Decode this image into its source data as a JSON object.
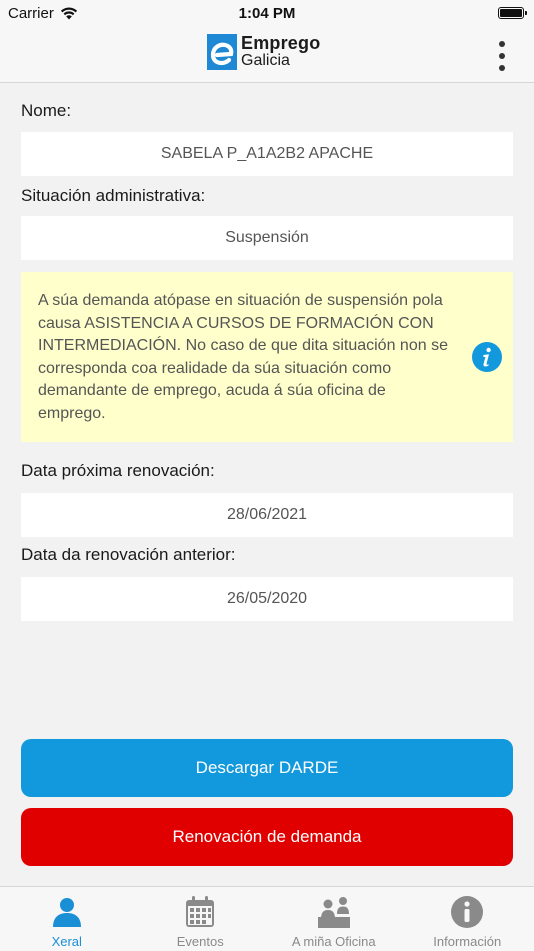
{
  "status_bar": {
    "carrier": "Carrier",
    "time": "1:04 PM"
  },
  "header": {
    "logo_line1": "Emprego",
    "logo_line2": "Galicia",
    "menu_icon": "more-vertical-icon"
  },
  "fields": {
    "nome": {
      "label": "Nome:",
      "value": "SABELA P_A1A2B2 APACHE"
    },
    "situacion": {
      "label": "Situación administrativa:",
      "value": "Suspensión"
    },
    "notice": {
      "text": "A súa demanda atópase en situación de suspensión pola causa ASISTENCIA A CURSOS DE FORMACIÓN CON INTERMEDIACIÓN. No caso de que dita situación non se corresponda coa realidade da súa situación como demandante de emprego, acuda á súa oficina de emprego.",
      "icon": "info-icon"
    },
    "proxima": {
      "label": "Data próxima renovación:",
      "value": "28/06/2021"
    },
    "anterior": {
      "label": "Data da renovación anterior:",
      "value": "26/05/2020"
    }
  },
  "buttons": {
    "darde": "Descargar DARDE",
    "renovacion": "Renovación de demanda"
  },
  "colors": {
    "accent": "#1298dc",
    "danger": "#e00000",
    "notice_bg": "#ffffcc",
    "tab_active": "#1a8fd6",
    "tab_inactive": "#8a8a8a"
  },
  "tabs": [
    {
      "label": "Xeral",
      "icon": "person-icon",
      "active": true
    },
    {
      "label": "Eventos",
      "icon": "calendar-icon",
      "active": false
    },
    {
      "label": "A miña Oficina",
      "icon": "office-icon",
      "active": false
    },
    {
      "label": "Información",
      "icon": "info-icon",
      "active": false
    }
  ]
}
